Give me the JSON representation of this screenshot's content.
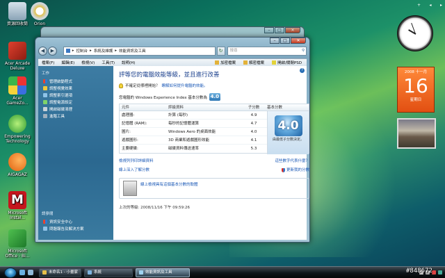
{
  "desktop_icons": [
    {
      "label": "資源回收筒",
      "name": "recycle-bin-icon",
      "color": "#9fb4c4"
    },
    {
      "label": "Orion",
      "name": "orion-icon",
      "color": "#e9e2d3"
    },
    {
      "label": "Acer Arcade Deluxe",
      "name": "acer-arcade-icon",
      "color": "#d33a2a"
    },
    {
      "label": "Acer GameZo...",
      "name": "acer-gamezone-icon",
      "color": "#3a7bd5"
    },
    {
      "label": "Empowering Technology",
      "name": "empowering-technology-icon",
      "color": "#4fb34a"
    },
    {
      "label": "AIGAGAZ",
      "name": "aigagaz-icon",
      "color": "#f07b1a"
    },
    {
      "label": "Microsoft Instal...",
      "name": "mcafee-icon",
      "color": "#c5161d"
    },
    {
      "label": "Microsoft Office - Bi...",
      "name": "office-icon",
      "color": "#2e9c3a"
    }
  ],
  "window": {
    "address": [
      "控制台",
      "系統及維護",
      "效能資訊及工具"
    ],
    "search_placeholder": "搜尋",
    "menu": [
      "檔案(F)",
      "編輯(E)",
      "檢視(V)",
      "工具(T)",
      "說明(H)"
    ],
    "toolbar_links": [
      "加密檔案",
      "解密檔案",
      "開啟/關閉PSD"
    ],
    "sidebar": {
      "title": "工作",
      "items": [
        "管理啟動程式",
        "調整視覺效果",
        "調整索引選項",
        "調整電源設定",
        "開啟磁碟清理",
        "進階工具"
      ],
      "see_also_title": "請參閱",
      "see_also": [
        "資訊安全中心",
        "問題報告及解決方案"
      ]
    },
    "content": {
      "headline": "評等您的電腦效能等級，並且進行改善",
      "tip_text": "不確定從哪裡開始？",
      "tip_link": "瞭解如何提升電腦的效能。",
      "score_label": "您電腦的 Windows Experience Index 基本分數為",
      "base_score": "4.0",
      "table_headers": [
        "元件",
        "評級資料",
        "子分數",
        "基本分數"
      ],
      "rows": [
        {
          "component": "處理器:",
          "detail": "計算 (每秒)",
          "score": "4.9"
        },
        {
          "component": "記憶體 (RAM):",
          "detail": "每秒的記憶體運算",
          "score": "4.7"
        },
        {
          "component": "圖片:",
          "detail": "Windows Aero 的桌面效能",
          "score": "4.0"
        },
        {
          "component": "遊戲圖形:",
          "detail": "3D 商業和遊戲圖形效能",
          "score": "4.1"
        },
        {
          "component": "主要硬碟:",
          "detail": "磁碟資料傳送速率",
          "score": "5.3"
        }
      ],
      "base_caption": "由最低子分數決定。",
      "link_print": "檢視列列印詳細資料",
      "link_meaning": "這些數字代表什麼？",
      "link_online": "線上深入了解分數",
      "link_update": "更新我的分數",
      "online_box_link": "線上檢視具有這個基本分數的軟體",
      "last_update": "上次的等級: 2008/11/16 下午 09:59:26"
    }
  },
  "gadgets": {
    "calendar_month": "2008 十一月",
    "calendar_day": "16",
    "calendar_weekday": "星期日"
  },
  "taskbar": {
    "tasks": [
      "未命名1 - 小畫家",
      "系統",
      "效能資訊及工具"
    ],
    "active_index": 2
  },
  "watermark": "#848672"
}
